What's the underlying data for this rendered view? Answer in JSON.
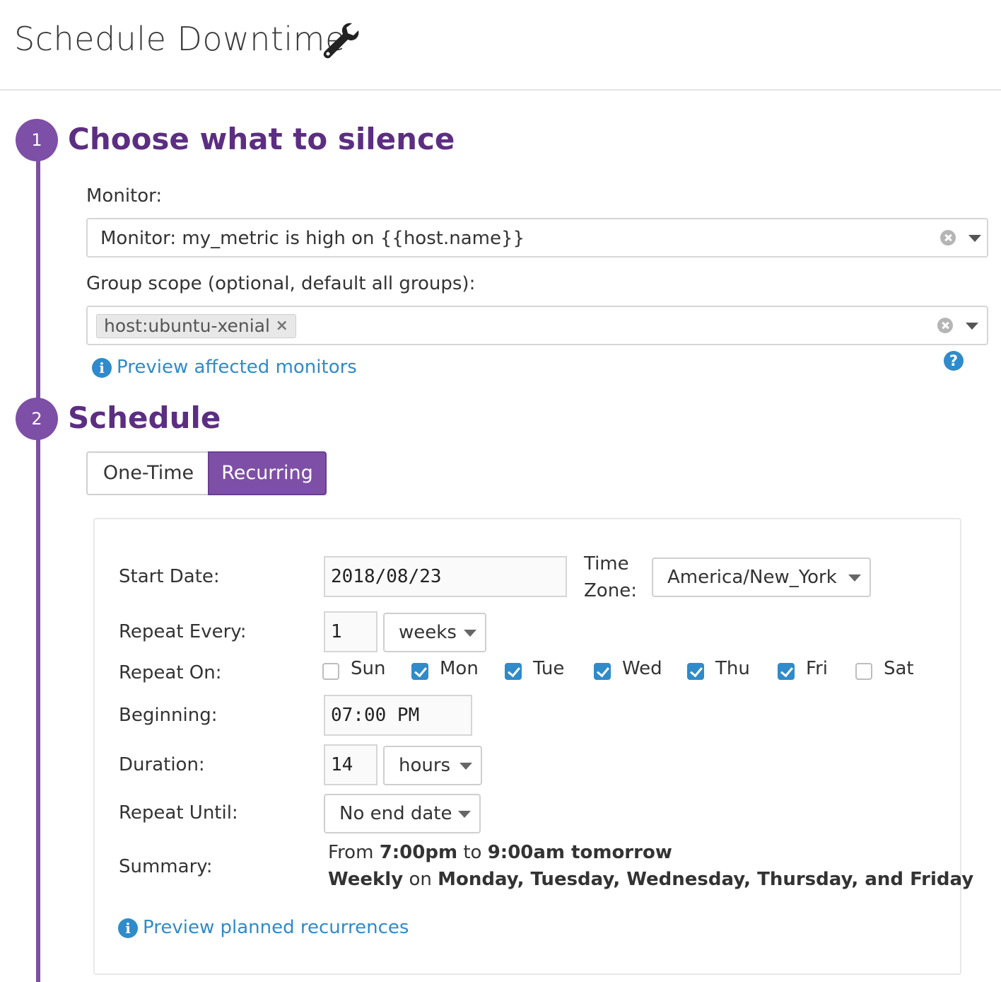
{
  "header": {
    "title": "Schedule Downtime",
    "icon": "wrench-icon"
  },
  "steps": [
    {
      "number": "1",
      "title": "Choose what to silence"
    },
    {
      "number": "2",
      "title": "Schedule"
    }
  ],
  "silence": {
    "monitor_label": "Monitor:",
    "monitor_value": "Monitor: my_metric is high on {{host.name}}",
    "scope_label": "Group scope (optional, default all groups):",
    "scope_tag": "host:ubuntu-xenial",
    "preview_link": "Preview affected monitors"
  },
  "schedule": {
    "tabs": [
      {
        "label": "One-Time",
        "active": false
      },
      {
        "label": "Recurring",
        "active": true
      }
    ],
    "start_date_label": "Start Date:",
    "start_date": "2018/08/23",
    "timezone_label": "Time Zone:",
    "timezone": "America/New_York",
    "repeat_every_label": "Repeat Every:",
    "repeat_every_value": "1",
    "repeat_every_unit": "weeks",
    "repeat_on_label": "Repeat On:",
    "days": [
      {
        "label": "Sun",
        "checked": false
      },
      {
        "label": "Mon",
        "checked": true
      },
      {
        "label": "Tue",
        "checked": true
      },
      {
        "label": "Wed",
        "checked": true
      },
      {
        "label": "Thu",
        "checked": true
      },
      {
        "label": "Fri",
        "checked": true
      },
      {
        "label": "Sat",
        "checked": false
      }
    ],
    "beginning_label": "Beginning:",
    "beginning": "07:00 PM",
    "duration_label": "Duration:",
    "duration_value": "14",
    "duration_unit": "hours",
    "repeat_until_label": "Repeat Until:",
    "repeat_until": "No end date",
    "summary_label": "Summary:",
    "summary": {
      "from_word": "From",
      "start": "7:00pm",
      "to_word": "to",
      "end": "9:00am tomorrow",
      "frequency": "Weekly",
      "on_word": "on",
      "days_text": "Monday, Tuesday, Wednesday, Thursday, and Friday"
    },
    "preview_link": "Preview planned recurrences"
  },
  "colors": {
    "accent": "#7e4fa6",
    "title": "#5c2e82",
    "link": "#2f8bc9"
  }
}
